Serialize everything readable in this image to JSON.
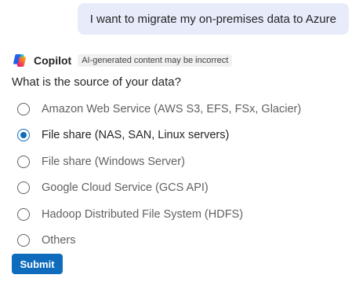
{
  "user_message": {
    "text": "I want to migrate my on-premises data to Azure"
  },
  "copilot": {
    "name": "Copilot",
    "icon": "copilot-logo-icon",
    "badge": "AI-generated content may be incorrect"
  },
  "question": {
    "text": "What is the source of your data?",
    "options": [
      {
        "label": "Amazon Web Service (AWS S3, EFS, FSx, Glacier)",
        "selected": false
      },
      {
        "label": "File share (NAS, SAN, Linux servers)",
        "selected": true
      },
      {
        "label": "File share (Windows Server)",
        "selected": false
      },
      {
        "label": "Google Cloud Service (GCS API)",
        "selected": false
      },
      {
        "label": "Hadoop Distributed File System (HDFS)",
        "selected": false
      },
      {
        "label": "Others",
        "selected": false
      }
    ]
  },
  "submit": {
    "label": "Submit"
  },
  "colors": {
    "accent": "#0f6cbd",
    "user_bubble": "#e8ebfa"
  }
}
